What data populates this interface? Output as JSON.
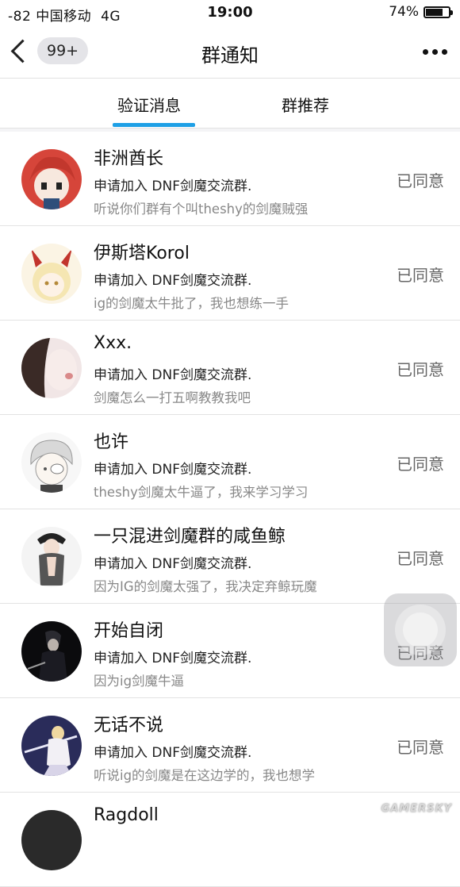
{
  "status": {
    "signal": "-82",
    "carrier": "中国移动",
    "network": "4G",
    "time": "19:00",
    "battery": "74%",
    "battery_level": 0.74
  },
  "header": {
    "badge": "99+",
    "title": "群通知"
  },
  "tabs": [
    {
      "label": "验证消息",
      "active": true
    },
    {
      "label": "群推荐",
      "active": false
    }
  ],
  "colors": {
    "accent": "#1ea0e6"
  },
  "items": [
    {
      "name": "非洲酋长",
      "request": "申请加入 DNF剑魔交流群.",
      "message": "听说你们群有个叫theshy的剑魔贼强",
      "status": "已同意"
    },
    {
      "name": "伊斯塔Korol",
      "request": "申请加入 DNF剑魔交流群.",
      "message": "ig的剑魔太牛批了，我也想练一手",
      "status": "已同意"
    },
    {
      "name": "Xxx.",
      "request": "申请加入 DNF剑魔交流群.",
      "message": "剑魔怎么一打五啊教教我吧",
      "status": "已同意"
    },
    {
      "name": "也许",
      "request": "申请加入 DNF剑魔交流群.",
      "message": "theshy剑魔太牛逼了，我来学习学习",
      "status": "已同意"
    },
    {
      "name": "一只混进剑魔群的咸鱼鲸",
      "request": "申请加入 DNF剑魔交流群.",
      "message": "因为IG的剑魔太强了，我决定弃鲸玩魔",
      "status": "已同意"
    },
    {
      "name": "开始自闭",
      "request": "申请加入 DNF剑魔交流群.",
      "message": "因为ig剑魔牛逼",
      "status": "已同意"
    },
    {
      "name": "无话不说",
      "request": "申请加入 DNF剑魔交流群.",
      "message": "听说ig的剑魔是在这边学的，我也想学",
      "status": "已同意"
    },
    {
      "name": "Ragdoll",
      "request": "",
      "message": "",
      "status": ""
    }
  ],
  "watermark": "GAMERSKY"
}
